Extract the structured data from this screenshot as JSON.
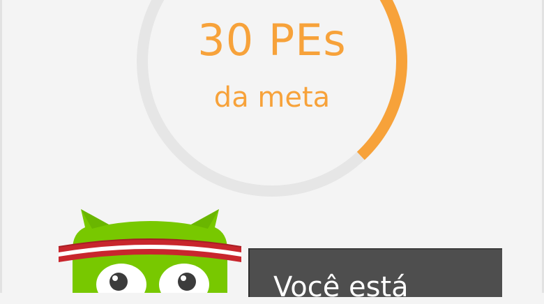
{
  "goal": {
    "value_text": "30 PEs",
    "caption": "da meta",
    "progress_fraction": 0.38,
    "track_color": "#e6e6e6",
    "progress_color": "#f7a23a"
  },
  "mascot": {
    "icon": "owl-mascot-icon",
    "body_color": "#78c800",
    "headband_colors": [
      "#c8262d",
      "#ffffff"
    ]
  },
  "message": {
    "text": "Você está"
  }
}
